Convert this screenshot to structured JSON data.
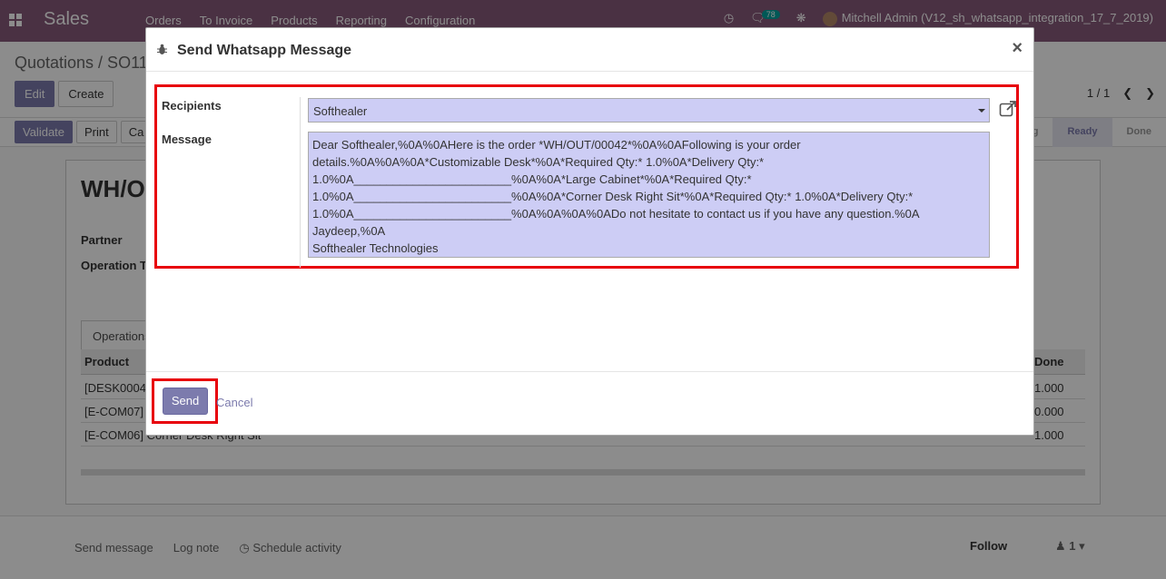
{
  "topbar": {
    "app_name": "Sales",
    "menu": [
      "Orders",
      "To Invoice",
      "Products",
      "Reporting",
      "Configuration"
    ],
    "message_count": "78",
    "user": "Mitchell Admin (V12_sh_whatsapp_integration_17_7_2019)"
  },
  "control_panel": {
    "breadcrumb": "Quotations / SO11",
    "edit_label": "Edit",
    "create_label": "Create",
    "pager": "1 / 1",
    "validate_label": "Validate",
    "print_label": "Print",
    "cancel_label": "Ca",
    "stages": [
      "ng",
      "Ready",
      "Done"
    ]
  },
  "sheet": {
    "title": "WH/O",
    "partner_label": "Partner",
    "operation_label": "Operation T",
    "tab_label": "Operations",
    "col_product": "Product",
    "col_done": "Done",
    "rows": [
      {
        "product": "[DESK0004",
        "done": "1.000"
      },
      {
        "product": "[E-COM07]",
        "done": "0.000"
      },
      {
        "product": "[E-COM06] Corner Desk Right Sit",
        "done": "1.000"
      }
    ]
  },
  "chatter": {
    "send_message": "Send message",
    "log_note": "Log note",
    "schedule_activity": "Schedule activity",
    "follow": "Follow",
    "followers": "1"
  },
  "dialog": {
    "title": "Send Whatsapp Message",
    "close": "×",
    "recipients_label": "Recipients",
    "recipients_value": "Softhealer",
    "message_label": "Message",
    "message_text": "Dear Softhealer,%0A%0AHere is the order *WH/OUT/00042*%0A%0AFollowing is your order\ndetails.%0A%0A%0A*Customizable Desk*%0A*Required Qty:* 1.0%0A*Delivery Qty:*\n1.0%0A________________________%0A%0A*Large Cabinet*%0A*Required Qty:*\n1.0%0A________________________%0A%0A*Corner Desk Right Sit*%0A*Required Qty:* 1.0%0A*Delivery Qty:*\n1.0%0A________________________%0A%0A%0A%0ADo not hesitate to contact us if you have any question.%0A\nJaydeep,%0A\nSofthealer Technologies",
    "send_label": "Send",
    "cancel_label": "Cancel",
    "highlight_color": "#e8000b",
    "field_bg": "#cdcdf5"
  }
}
